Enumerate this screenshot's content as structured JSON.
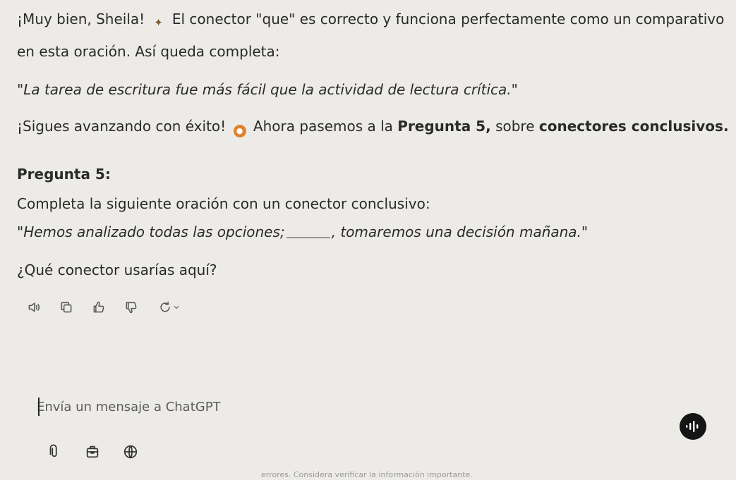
{
  "message": {
    "line1_a": "¡Muy bien, Sheila!",
    "line1_b": "El conector \"que\" es correcto y funciona perfectamente como un comparativo",
    "line2": "en esta oración. Así queda completa:",
    "quote": "\"La tarea de escritura fue más fácil que la actividad de lectura crítica.\"",
    "line4_a": "¡Sigues avanzando con éxito!",
    "line4_b": "Ahora pasemos a la",
    "line4_c": "Pregunta 5,",
    "line4_d": "sobre",
    "line4_e": "conectores conclusivos.",
    "question_heading": "Pregunta 5:",
    "instruction": "Completa la siguiente oración con un conector conclusivo:",
    "sentence_a": "\"Hemos analizado todas las opciones;",
    "sentence_b": ", tomaremos una decisión mañana.\"",
    "ask": "¿Qué conector usarías aquí?",
    "emoji1": "star-emoji",
    "emoji2": "orange-circle-emoji"
  },
  "actions": {
    "icons": [
      "speaker-icon",
      "copy-icon",
      "thumbs-up-icon",
      "thumbs-down-icon",
      "regenerate-icon",
      "chevron-down-icon"
    ]
  },
  "composer": {
    "placeholder": "Envía un mensaje a ChatGPT",
    "value": "",
    "tools": [
      "attach-icon",
      "tools-icon",
      "globe-icon"
    ],
    "voice_icon": "voice-mode-icon"
  },
  "footer": {
    "disclaimer": "errores. Considera verificar la información importante."
  },
  "colors": {
    "background": "#ecebe7",
    "text": "#2a2a2a",
    "accent_emoji": "#e0822c",
    "voice_button": "#151515"
  }
}
